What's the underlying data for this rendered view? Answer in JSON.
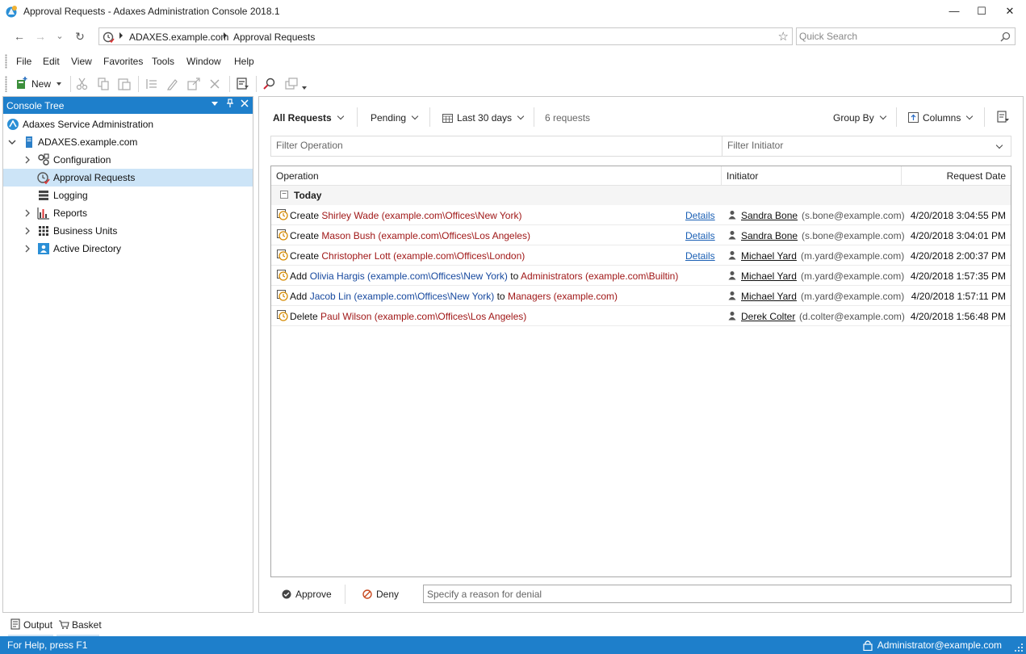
{
  "window": {
    "title": "Approval Requests - Adaxes Administration Console 2018.1",
    "minimize": "—",
    "maximize": "☐",
    "close": "✕"
  },
  "nav": {
    "back": "←",
    "forward": "→",
    "dropdown": "⌄",
    "refresh": "↻",
    "breadcrumb": [
      "ADAXES.example.com",
      "Approval Requests"
    ],
    "favorite_star": "☆",
    "search_placeholder": "Quick Search"
  },
  "menu": [
    "File",
    "Edit",
    "View",
    "Favorites",
    "Tools",
    "Window",
    "Help"
  ],
  "toolbar": {
    "new_label": "New"
  },
  "console_tree": {
    "title": "Console Tree",
    "items": [
      {
        "label": "Adaxes Service Administration",
        "icon": "service-admin-icon"
      },
      {
        "label": "ADAXES.example.com",
        "icon": "domain-server-icon"
      },
      {
        "label": "Configuration",
        "icon": "configuration-icon"
      },
      {
        "label": "Approval Requests",
        "icon": "approval-requests-icon"
      },
      {
        "label": "Logging",
        "icon": "logging-icon"
      },
      {
        "label": "Reports",
        "icon": "reports-icon"
      },
      {
        "label": "Business Units",
        "icon": "business-units-icon"
      },
      {
        "label": "Active Directory",
        "icon": "active-directory-icon"
      }
    ]
  },
  "filters": {
    "scope": "All Requests",
    "status": "Pending",
    "period": "Last 30 days",
    "count": "6 requests",
    "group_by": "Group By",
    "columns": "Columns",
    "filter_operation_placeholder": "Filter Operation",
    "filter_initiator_placeholder": "Filter Initiator"
  },
  "grid": {
    "columns": [
      "Operation",
      "Initiator",
      "Request Date"
    ],
    "group_label": "Today",
    "group_toggle": "−",
    "details_label": "Details",
    "rows": [
      {
        "op_verb": "Create",
        "op_target": "Shirley Wade (example.com\\Offices\\New York)",
        "op_connector": "",
        "op_group": "",
        "details": true,
        "initiator": "Sandra Bone",
        "email": "(s.bone@example.com)",
        "date": "4/20/2018 3:04:55 PM"
      },
      {
        "op_verb": "Create",
        "op_target": "Mason Bush (example.com\\Offices\\Los Angeles)",
        "op_connector": "",
        "op_group": "",
        "details": true,
        "initiator": "Sandra Bone",
        "email": "(s.bone@example.com)",
        "date": "4/20/2018 3:04:01 PM"
      },
      {
        "op_verb": "Create",
        "op_target": "Christopher Lott (example.com\\Offices\\London)",
        "op_connector": "",
        "op_group": "",
        "details": true,
        "initiator": "Michael Yard",
        "email": "(m.yard@example.com)",
        "date": "4/20/2018 2:00:37 PM"
      },
      {
        "op_verb": "Add",
        "op_target": "Olivia Hargis (example.com\\Offices\\New York)",
        "op_connector": "to",
        "op_group": "Administrators (example.com\\Builtin)",
        "details": false,
        "initiator": "Michael Yard",
        "email": "(m.yard@example.com)",
        "date": "4/20/2018 1:57:35 PM"
      },
      {
        "op_verb": "Add",
        "op_target": "Jacob Lin (example.com\\Offices\\New York)",
        "op_connector": "to",
        "op_group": "Managers (example.com)",
        "details": false,
        "initiator": "Michael Yard",
        "email": "(m.yard@example.com)",
        "date": "4/20/2018 1:57:11 PM"
      },
      {
        "op_verb": "Delete",
        "op_target": "Paul Wilson (example.com\\Offices\\Los Angeles)",
        "op_connector": "",
        "op_group": "",
        "details": false,
        "initiator": "Derek Colter",
        "email": "(d.colter@example.com)",
        "date": "4/20/2018 1:56:48 PM"
      }
    ]
  },
  "actions": {
    "approve": "Approve",
    "deny": "Deny",
    "reason_placeholder": "Specify a reason for denial"
  },
  "bottom_tabs": [
    "Output",
    "Basket"
  ],
  "status": {
    "help": "For Help, press F1",
    "user": "Administrator@example.com"
  },
  "colors": {
    "accent": "#1e7fcb",
    "selection": "#cce4f7",
    "target_red": "#a01818",
    "target_blue": "#16489e",
    "link": "#1a5fb4"
  }
}
